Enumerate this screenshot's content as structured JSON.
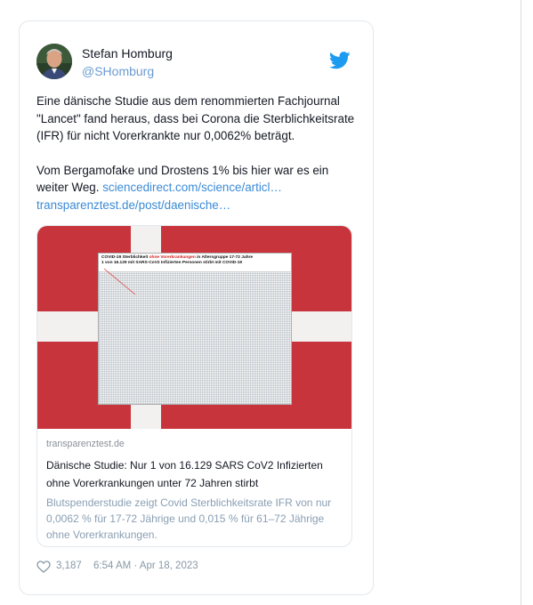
{
  "tweet": {
    "author_name": "Stefan Homburg",
    "author_handle": "@SHomburg",
    "text_para1": "Eine dänische Studie aus dem renommierten Fachjournal \"Lancet\" fand heraus, dass bei Corona die Sterblichkeitsrate (IFR) für nicht Vorerkrankte nur 0,0062% beträgt.",
    "text_para2": "Vom Bergamofake und Drostens 1% bis hier war es ein weiter Weg.",
    "link1": "sciencedirect.com/science/articl…",
    "link2": "transparenztest.de/post/daenische…",
    "likes": "3,187",
    "timestamp": "6:54 AM · Apr 18, 2023"
  },
  "card": {
    "domain": "transparenztest.de",
    "title": "Dänische Studie: Nur 1 von 16.129 SARS CoV2 Infizierten ohne Vorerkrankungen unter 72 Jahren stirbt",
    "description": "Blutspenderstudie zeigt Covid Sterblichkeitsrate IFR von nur 0,0062 % für 17-72 Jährige und 0,015 % für 61–72 Jährige ohne Vorerkrankungen.",
    "image": {
      "line1_a": "COVID-19 Sterblichkeit ",
      "line1_red": "ohne Vorerkrankungen",
      "line1_b": " in Altersgruppe 17-72 Jahre",
      "line2": "1 von 16.129 mit SARS-CoV2 Infizierten Personen stirbt mit COVID-19"
    }
  },
  "icons": {
    "twitter_logo": "twitter-bird-icon",
    "like": "heart-icon"
  },
  "colors": {
    "link": "#3a8bd6",
    "handle": "#6b9bd1",
    "twitter_blue": "#1d9bf0",
    "flag_red": "#c8343b",
    "meta_grey": "#8899a6"
  }
}
